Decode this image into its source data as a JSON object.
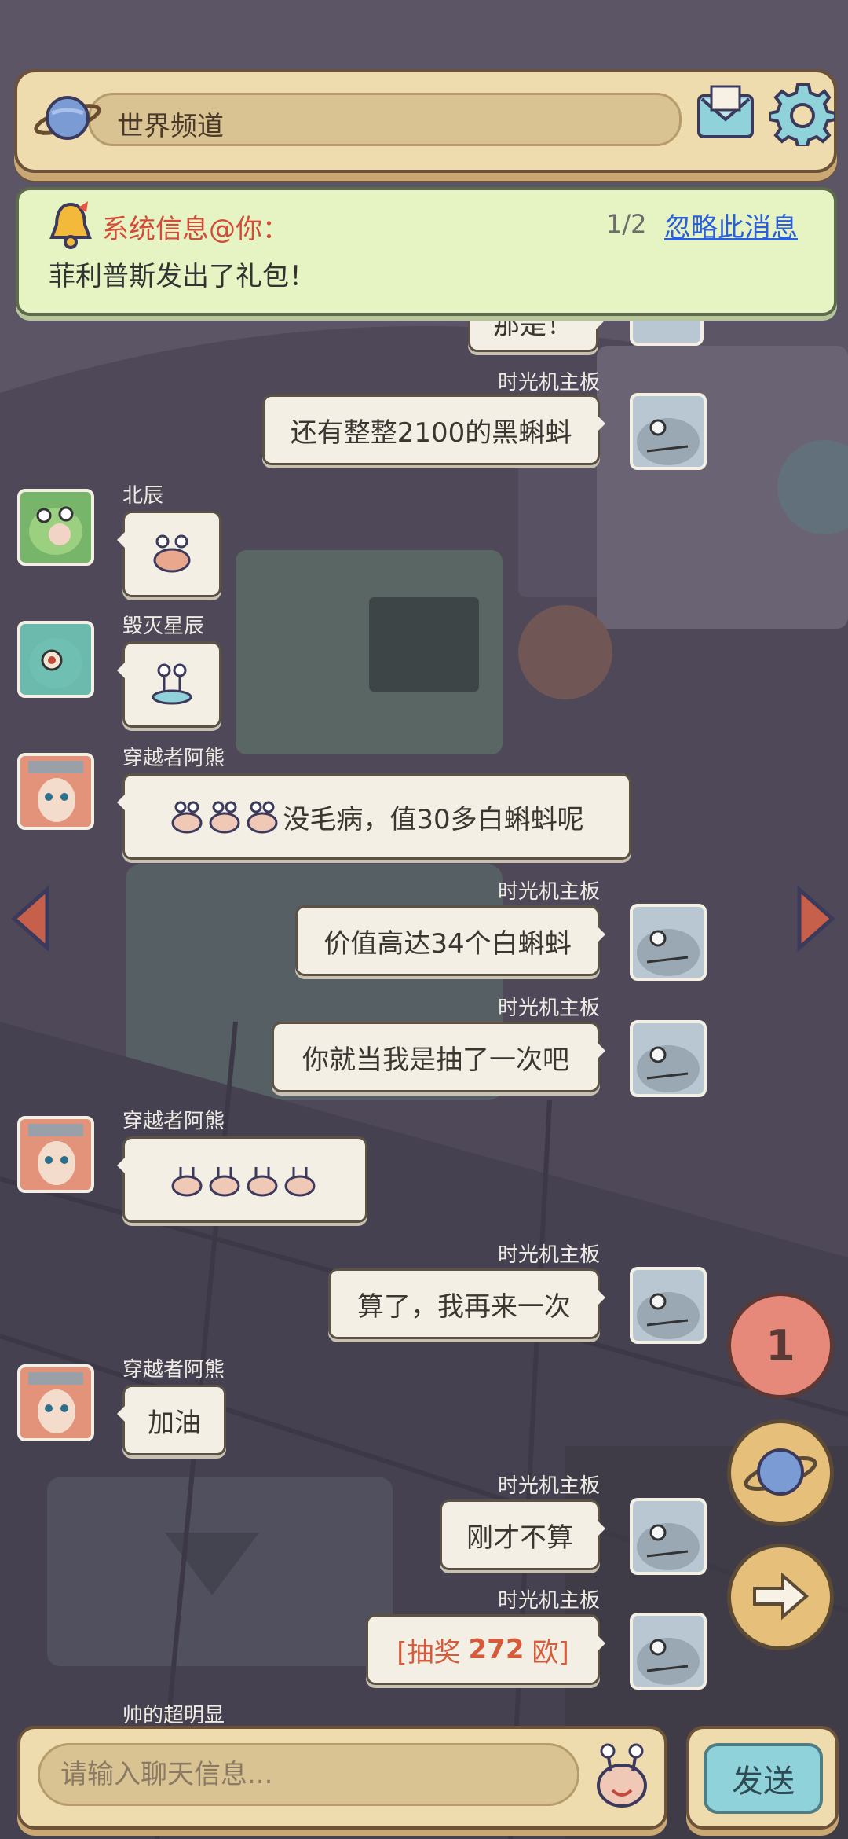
{
  "header": {
    "channel_label": "世界频道",
    "planet_icon": "planet-icon",
    "mail_icon": "mail-icon",
    "settings_icon": "gear-icon"
  },
  "notice": {
    "title": "系统信息@你：",
    "count": "1/2",
    "ignore_label": "忽略此消息",
    "body": "菲利普斯发出了礼包！"
  },
  "messages": {
    "m0": {
      "text": "那是！"
    },
    "m1": {
      "sender": "时光机主板",
      "text": "还有整整2100的黑蝌蚪"
    },
    "m2": {
      "sender": "北辰",
      "emoji": "crab-emoji"
    },
    "m3": {
      "sender": "毁灭星辰",
      "emoji": "snail-emoji"
    },
    "m4": {
      "sender": "穿越者阿熊",
      "text": "没毛病，值30多白蝌蚪呢"
    },
    "m5": {
      "sender": "时光机主板",
      "text": "价值高达34个白蝌蚪"
    },
    "m6": {
      "sender": "时光机主板",
      "text": "你就当我是抽了一次吧"
    },
    "m7": {
      "sender": "穿越者阿熊",
      "emoji": "sprout-emoji"
    },
    "m8": {
      "sender": "时光机主板",
      "text": "算了，我再来一次"
    },
    "m9": {
      "sender": "穿越者阿熊",
      "text": "加油"
    },
    "m10": {
      "sender": "时光机主板",
      "text": "刚才不算"
    },
    "m11": {
      "sender": "时光机主板",
      "prefix": "[抽奖",
      "amount": "272",
      "suffix": "欧]"
    },
    "m12": {
      "sender": "帅的超明显"
    }
  },
  "side": {
    "left_arrow_icon": "arrow-left-icon",
    "right_arrow_icon": "arrow-right-icon",
    "badge_count": "1",
    "planet_button_icon": "planet-icon",
    "next_button_icon": "arrow-right-icon"
  },
  "input": {
    "placeholder": "请输入聊天信息...",
    "send_label": "发送",
    "emoji_icon": "tadpole-face-icon"
  },
  "colors": {
    "panel": "#efdcae",
    "notice_bg": "#e6f4c4",
    "accent_red": "#d44b3a",
    "link_blue": "#2b5fd9",
    "send_bg": "#8fd2d9"
  }
}
